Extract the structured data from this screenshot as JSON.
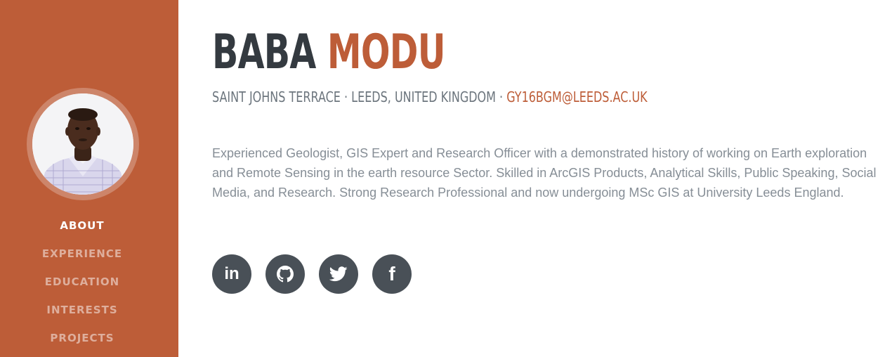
{
  "profile": {
    "first_name": "BABA",
    "last_name": "MODU",
    "address": "SAINT JOHNS TERRACE · LEEDS, UNITED KINGDOM · ",
    "email": "GY16BGM@LEEDS.AC.UK",
    "bio": "Experienced Geologist, GIS Expert and Research Officer with a demonstrated history of working on Earth exploration and Remote Sensing in the earth resource Sector. Skilled in ArcGIS Products, Analytical Skills, Public Speaking, Social Media, and Research. Strong Research Professional and now undergoing MSc GIS at University Leeds England."
  },
  "nav": {
    "items": [
      {
        "label": "ABOUT",
        "active": true
      },
      {
        "label": "EXPERIENCE",
        "active": false
      },
      {
        "label": "EDUCATION",
        "active": false
      },
      {
        "label": "INTERESTS",
        "active": false
      },
      {
        "label": "PROJECTS",
        "active": false
      }
    ]
  },
  "social": {
    "linkedin": {
      "icon": "linkedin-icon",
      "glyph": "in"
    },
    "github": {
      "icon": "github-icon"
    },
    "twitter": {
      "icon": "twitter-icon"
    },
    "facebook": {
      "icon": "facebook-icon",
      "glyph": "f"
    }
  },
  "colors": {
    "accent": "#bd5d38",
    "dark": "#343a40",
    "muted": "#868e96",
    "social_bg": "#495057"
  }
}
